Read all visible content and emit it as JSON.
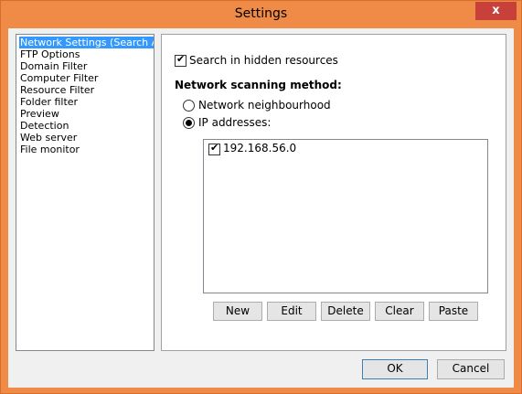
{
  "window": {
    "title": "Settings",
    "close_glyph": "x"
  },
  "sidebar": {
    "items": [
      {
        "label": "Network Settings (Search Area",
        "selected": true
      },
      {
        "label": "FTP Options"
      },
      {
        "label": "Domain Filter"
      },
      {
        "label": "Computer Filter"
      },
      {
        "label": "Resource Filter"
      },
      {
        "label": "Folder filter"
      },
      {
        "label": "Preview"
      },
      {
        "label": "Detection"
      },
      {
        "label": "Web server"
      },
      {
        "label": "File monitor"
      }
    ]
  },
  "network": {
    "search_hidden_label": "Search in hidden resources",
    "search_hidden_checked": true,
    "scanning_method_label": "Network scanning method:",
    "neighbourhood_label": "Network neighbourhood",
    "neighbourhood_selected": false,
    "ip_label": "IP addresses:",
    "ip_selected": true,
    "ip_list": [
      {
        "address": "192.168.56.0",
        "checked": true
      }
    ],
    "buttons": {
      "new": "New",
      "edit": "Edit",
      "delete": "Delete",
      "clear": "Clear",
      "paste": "Paste"
    }
  },
  "footer": {
    "ok": "OK",
    "cancel": "Cancel"
  }
}
